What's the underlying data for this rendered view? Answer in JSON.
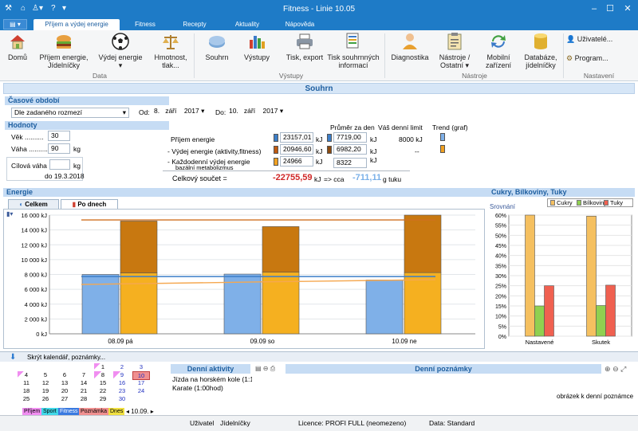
{
  "window": {
    "title": "Fitness - Linie 10.05"
  },
  "ribbon_tabs": [
    {
      "label": "Příjem a výdej energie",
      "active": true
    },
    {
      "label": "Fitness"
    },
    {
      "label": "Recepty"
    },
    {
      "label": "Aktuality"
    },
    {
      "label": "Nápověda"
    }
  ],
  "ribbon": {
    "buttons": [
      "Domů",
      "Příjem energie, Jídelníčky",
      "Výdej energie",
      "Hmotnost, tlak...",
      "Souhrn",
      "Výstupy",
      "Tisk, export",
      "Tisk souhrnných informací",
      "Diagnostika",
      "Nástroje / Ostatní",
      "Mobilní zařízení",
      "Databáze, jídelníčky",
      "Uživatelé...",
      "Program..."
    ],
    "groups": [
      "Data",
      "Výstupy",
      "Nástroje",
      "Nastavení"
    ]
  },
  "summary_title": "Souhrn",
  "period": {
    "heading": "Časové období",
    "select_value": "Dle zadaného rozmezí",
    "from_label": "Od:",
    "from_day": "8.",
    "from_month": "září",
    "from_year": "2017",
    "to_label": "Do:",
    "to_day": "10.",
    "to_month": "září",
    "to_year": "2017"
  },
  "values": {
    "heading": "Hodnoty",
    "age_label": "Věk ..........",
    "age": "30",
    "weight_label": "Váha ..........",
    "weight": "90",
    "weight_unit": "kg",
    "target_label": "Cílová váha",
    "target_unit": "kg",
    "target_date": "do 19.3.2018"
  },
  "energy_summary": {
    "avg_header": "Průměr za den",
    "limit_header": "Váš denní limit",
    "trend_header": "Trend (graf)",
    "rows": [
      {
        "label": "Příjem energie",
        "total": "23157,01",
        "unit": "kJ",
        "avg": "7719,00",
        "avg_unit": "kJ",
        "limit": "8000 kJ",
        "color": "#3c7ec8"
      },
      {
        "label": "- Výdej energie (aktivity,fitness)",
        "total": "20946,60",
        "unit": "kJ",
        "avg": "6982,20",
        "avg_unit": "kJ",
        "limit": "--",
        "color": "#c05a10"
      },
      {
        "label": "- Každodenní výdej energie",
        "sublabel": "bazální metabolizmus",
        "total": "24966",
        "unit": "kJ",
        "avg": "8322",
        "avg_unit": "kJ",
        "color": "#f0a020"
      }
    ],
    "total_label": "Celkový součet =",
    "total_value": "-22755,59",
    "total_unit": "kJ",
    "arrow": "=> cca",
    "fat_value": "-711,11",
    "fat_unit": "g tuku"
  },
  "energie": {
    "heading": "Energie",
    "tabs": [
      "Celkem",
      "Po dnech"
    ]
  },
  "chart_data": [
    {
      "type": "bar",
      "categories": [
        "08.09 pá",
        "09.09 so",
        "10.09 ne"
      ],
      "y_ticks": [
        "16 000 kJ",
        "14 000 kJ",
        "12 000 kJ",
        "10 000 kJ",
        "8 000 kJ",
        "6 000 kJ",
        "4 000 kJ",
        "2 000 kJ",
        "0 kJ"
      ],
      "ylim": [
        0,
        16000
      ],
      "series": [
        {
          "values": [
            8000,
            8050,
            7250
          ],
          "color": "#7fb0e8"
        },
        {
          "values": [
            8200,
            8300,
            8250
          ],
          "color": "#f5b020"
        },
        {
          "values": [
            7000,
            6150,
            7750
          ],
          "color": "#c87810"
        }
      ],
      "lines": [
        {
          "values": [
            7719,
            7719,
            7719
          ],
          "color": "#3c7ec8"
        },
        {
          "values": [
            6650,
            7000,
            7300
          ],
          "color": "#f5a850"
        },
        {
          "values": [
            15350,
            15350,
            15350
          ],
          "color": "#d07020"
        }
      ]
    },
    {
      "type": "bar",
      "title": "Cukry, Bílkoviny, Tuky",
      "subtitle": "Srovnání",
      "legend": [
        "Cukry",
        "Bílkoviny",
        "Tuky"
      ],
      "categories": [
        "Nastavené",
        "Skutek"
      ],
      "y_ticks": [
        "60%",
        "55%",
        "50%",
        "45%",
        "40%",
        "35%",
        "30%",
        "25%",
        "20%",
        "15%",
        "10%",
        "5%",
        "0%"
      ],
      "ylim": [
        0,
        60
      ],
      "series": [
        {
          "name": "Cukry",
          "values": [
            60,
            59.5
          ],
          "color": "#f5c060"
        },
        {
          "name": "Bílkoviny",
          "values": [
            15,
            15.2
          ],
          "color": "#90d050"
        },
        {
          "name": "Tuky",
          "values": [
            25,
            25.3
          ],
          "color": "#f06050"
        }
      ]
    }
  ],
  "bottom": {
    "hide_label": "Skrýt kalendář, poznámky...",
    "activities_title": "Denní aktivity",
    "activities": [
      "Jízda na horském kole (1:15h",
      "Karate (1:00hod)"
    ],
    "notes_title": "Denní poznámky",
    "notes_hint": "obrázek k denní poznámce",
    "calendar": [
      [
        "1",
        "2",
        "3"
      ],
      [
        "4",
        "5",
        "6",
        "7",
        "8",
        "9",
        "10"
      ],
      [
        "11",
        "12",
        "13",
        "14",
        "15",
        "16",
        "17"
      ],
      [
        "18",
        "19",
        "20",
        "21",
        "22",
        "23",
        "24"
      ],
      [
        "25",
        "26",
        "27",
        "28",
        "29",
        "30"
      ]
    ],
    "legend": [
      "Příjem",
      "Sport",
      "Fitness",
      "Poznámka",
      "Dnes"
    ],
    "date_nav": "10.09."
  },
  "status": {
    "user_label": "Uživatel",
    "user": "Jídelníčky",
    "license": "Licence: PROFI FULL (neomezeno)",
    "data": "Data: Standard"
  }
}
